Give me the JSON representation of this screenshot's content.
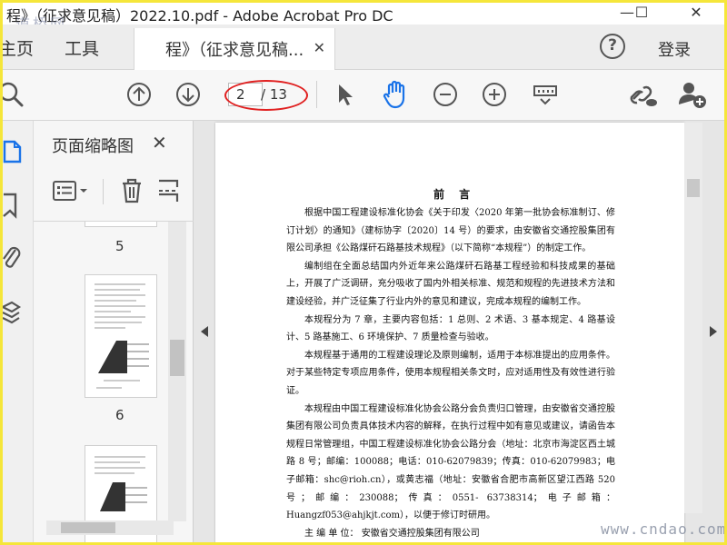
{
  "window": {
    "title": "程》（征求意见稿）2022.10.pdf - Adobe Acrobat Pro DC",
    "minimize": "—",
    "maximize": "☐",
    "close": "✕"
  },
  "watermarks": {
    "top_left": "道桥网",
    "bottom_right": "www.cndao.com"
  },
  "tabs": {
    "home": "主页",
    "tools": "工具",
    "document": "程》（征求意见稿...",
    "document_close": "✕",
    "help": "?",
    "login": "登录"
  },
  "toolbar": {
    "icons": [
      "search-icon",
      "prev-page-icon",
      "next-page-icon",
      "select-cursor-icon",
      "hand-tool-icon",
      "zoom-out-icon",
      "zoom-in-icon",
      "page-display-icon",
      "share-link-icon",
      "add-user-icon"
    ],
    "current_page": "2",
    "total_pages": "/ 13",
    "highlight_color": "#e02020",
    "accent_color": "#1a73e8"
  },
  "panel": {
    "title": "页面缩略图",
    "close": "✕",
    "thumbnails": [
      {
        "label": "5"
      },
      {
        "label": "6"
      },
      {
        "label": ""
      }
    ]
  },
  "document": {
    "heading": "前  言",
    "paragraphs": [
      "根据中国工程建设标准化协会《关于印发〈2020 年第一批协会标准制订、修订计划〉的通知》（建标协字〔2020〕14 号）的要求，由安徽省交通控股集团有限公司承担《公路煤矸石路基技术规程》（以下简称“本规程”）的制定工作。",
      "编制组在全面总结国内外近年来公路煤矸石路基工程经验和科技成果的基础上，开展了广泛调研，充分吸收了国内外相关标准、规范和规程的先进技术方法和建设经验，并广泛征集了行业内外的意见和建议，完成本规程的编制工作。",
      "本规程分为 7 章，主要内容包括：1 总则、2 术语、3 基本规定、4 路基设计、5 路基施工、6 环境保护、7 质量检查与验收。",
      "本规程基于通用的工程建设理论及原则编制，适用于本标准提出的应用条件。对于某些特定专项应用条件，使用本规程相关条文时，应对适用性及有效性进行验证。",
      "本规程由中国工程建设标准化协会公路分会负责归口管理，由安徽省交通控股集团有限公司负责具体技术内容的解释，在执行过程中如有意见或建议，请函告本规程日常管理组，中国工程建设标准化协会公路分会（地址：北京市海淀区西土城路 8 号；邮编：100088；电话：010-62079839；传真：010-62079983；电子邮箱：shc@rioh.cn），或黄志福（地址：安徽省合肥市高新区望江西路 520 号；邮编：230088；传真：0551- 63738314；电子邮箱：Huangzf053@ahjkjt.com），以便于修订时研用。"
    ],
    "last_line": "主 编 单 位： 安徽省交通控股集团有限公司"
  }
}
